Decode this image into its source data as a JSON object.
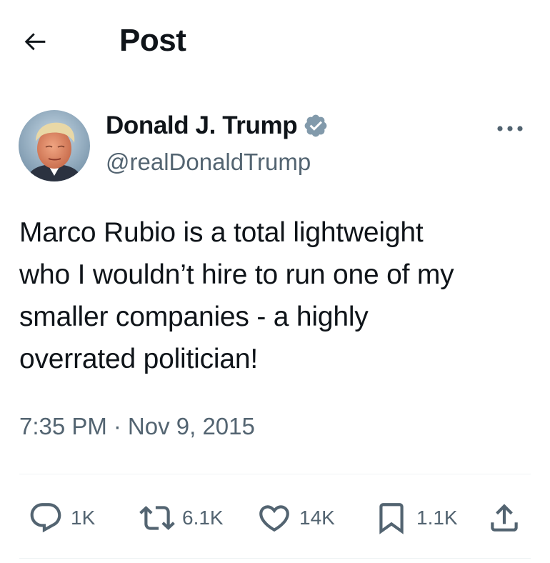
{
  "header": {
    "title": "Post",
    "back_icon": "arrow-left-icon"
  },
  "author": {
    "display_name": "Donald J. Trump",
    "handle": "@realDonaldTrump",
    "verified": true,
    "verified_color": "#829aab",
    "avatar_icon": "profile-photo"
  },
  "tweet": {
    "lines": [
      "Marco Rubio is a total lightweight",
      "who I wouldn’t hire to run one of my",
      "smaller companies - a highly",
      "overrated politician!"
    ]
  },
  "meta": {
    "time": "7:35 PM",
    "separator": "·",
    "date": "Nov 9, 2015"
  },
  "actions": {
    "reply": {
      "icon": "reply-icon",
      "count": "1K"
    },
    "retweet": {
      "icon": "retweet-icon",
      "count": "6.1K"
    },
    "like": {
      "icon": "heart-icon",
      "count": "14K"
    },
    "bookmark": {
      "icon": "bookmark-icon",
      "count": "1.1K"
    },
    "share": {
      "icon": "share-icon"
    }
  },
  "colors": {
    "text_primary": "#0f1419",
    "text_secondary": "#536471",
    "divider": "#eff3f4"
  }
}
